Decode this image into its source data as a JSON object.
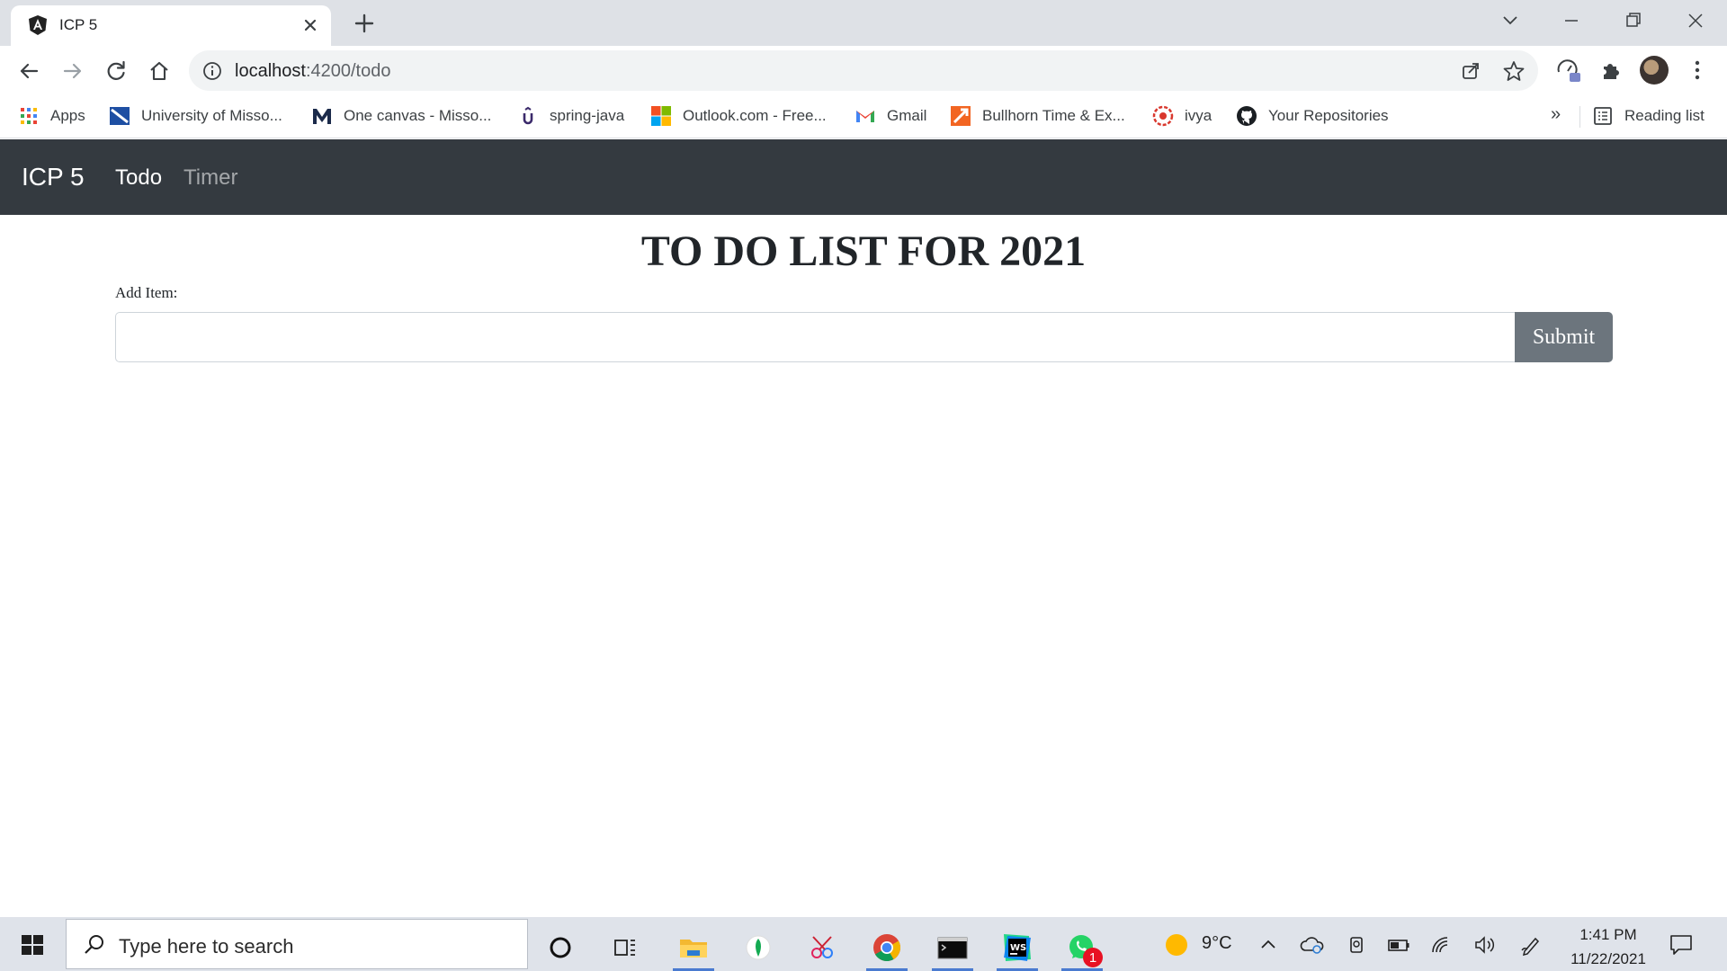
{
  "browser": {
    "tab_title": "ICP 5",
    "url_host": "localhost",
    "url_path": ":4200/todo",
    "bookmarks": [
      {
        "label": "Apps",
        "icon": "apps-grid-icon"
      },
      {
        "label": "University of Misso...",
        "icon": "university-icon"
      },
      {
        "label": "One canvas - Misso...",
        "icon": "canvas-m-icon"
      },
      {
        "label": "spring-java",
        "icon": "spring-java-icon"
      },
      {
        "label": "Outlook.com - Free...",
        "icon": "microsoft-icon"
      },
      {
        "label": "Gmail",
        "icon": "gmail-icon"
      },
      {
        "label": "Bullhorn Time & Ex...",
        "icon": "bullhorn-icon"
      },
      {
        "label": "ivya",
        "icon": "ivya-icon"
      },
      {
        "label": "Your Repositories",
        "icon": "github-icon"
      }
    ],
    "overflow_label": "»",
    "reading_list_label": "Reading list"
  },
  "app": {
    "brand": "ICP 5",
    "nav": [
      {
        "label": "Todo",
        "active": true
      },
      {
        "label": "Timer",
        "active": false
      }
    ],
    "navbar_color": "#343a40"
  },
  "page": {
    "title": "TO DO LIST FOR 2021",
    "add_item_label": "Add Item:",
    "input_value": "",
    "submit_label": "Submit",
    "submit_color": "#6c757d"
  },
  "taskbar": {
    "search_placeholder": "Type here to search",
    "weather_temp": "9°C",
    "time": "1:41 PM",
    "date": "11/22/2021",
    "whatsapp_badge": "1"
  }
}
